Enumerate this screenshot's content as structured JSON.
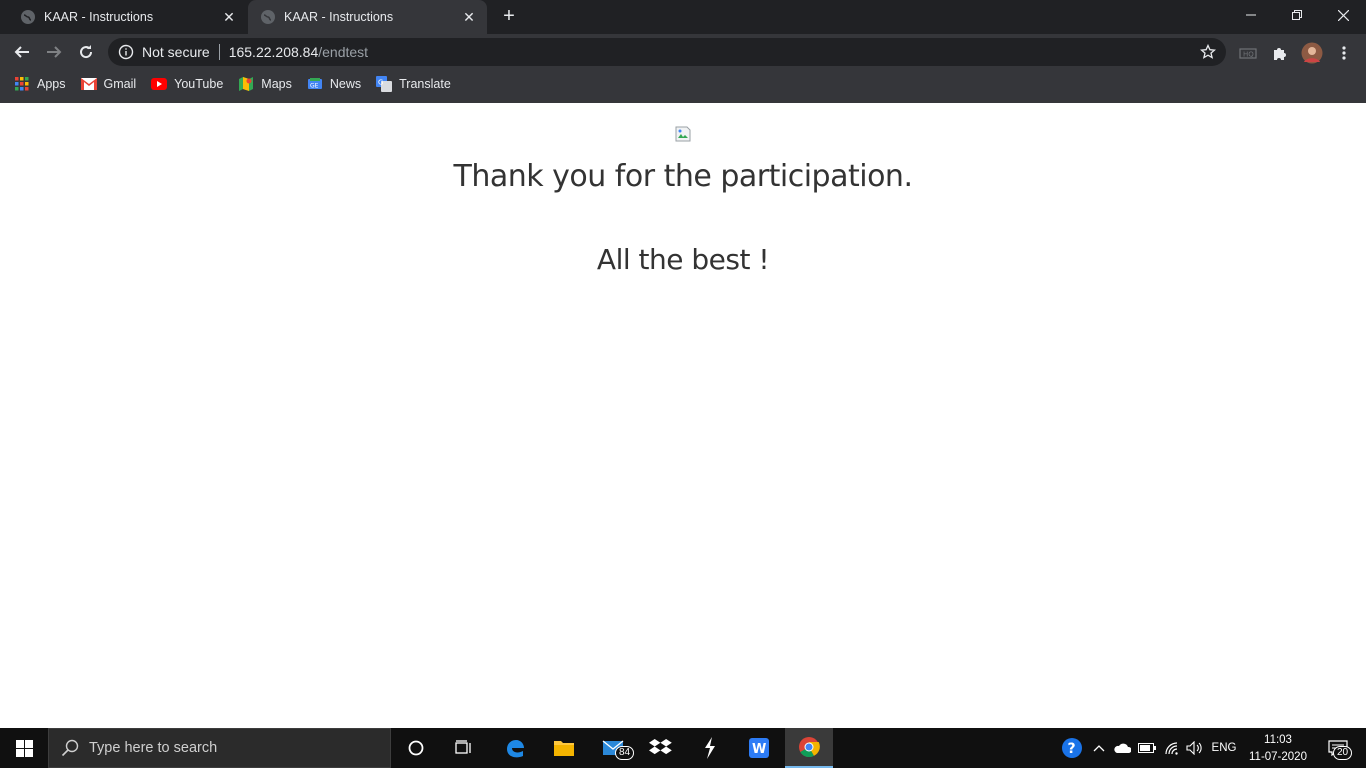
{
  "browser": {
    "tabs": [
      {
        "title": "KAAR - Instructions",
        "active": false
      },
      {
        "title": "KAAR - Instructions",
        "active": true
      }
    ],
    "address": {
      "security_label": "Not secure",
      "host": "165.22.208.84",
      "path": "/endtest"
    },
    "bookmarks": [
      {
        "label": "Apps",
        "icon": "apps-grid-icon"
      },
      {
        "label": "Gmail",
        "icon": "gmail-icon"
      },
      {
        "label": "YouTube",
        "icon": "youtube-icon"
      },
      {
        "label": "Maps",
        "icon": "maps-icon"
      },
      {
        "label": "News",
        "icon": "news-icon"
      },
      {
        "label": "Translate",
        "icon": "translate-icon"
      }
    ]
  },
  "page": {
    "message": "Thank you for the participation.",
    "wish": "All the best !"
  },
  "taskbar": {
    "search_placeholder": "Type here to search",
    "mail_badge": "84",
    "language": "ENG",
    "time": "11:03",
    "date": "11-07-2020",
    "notification_count": "20"
  },
  "colors": {
    "tabstrip": "#202124",
    "toolbar": "#35363a",
    "text": "#333333",
    "taskbar": "#101010"
  }
}
